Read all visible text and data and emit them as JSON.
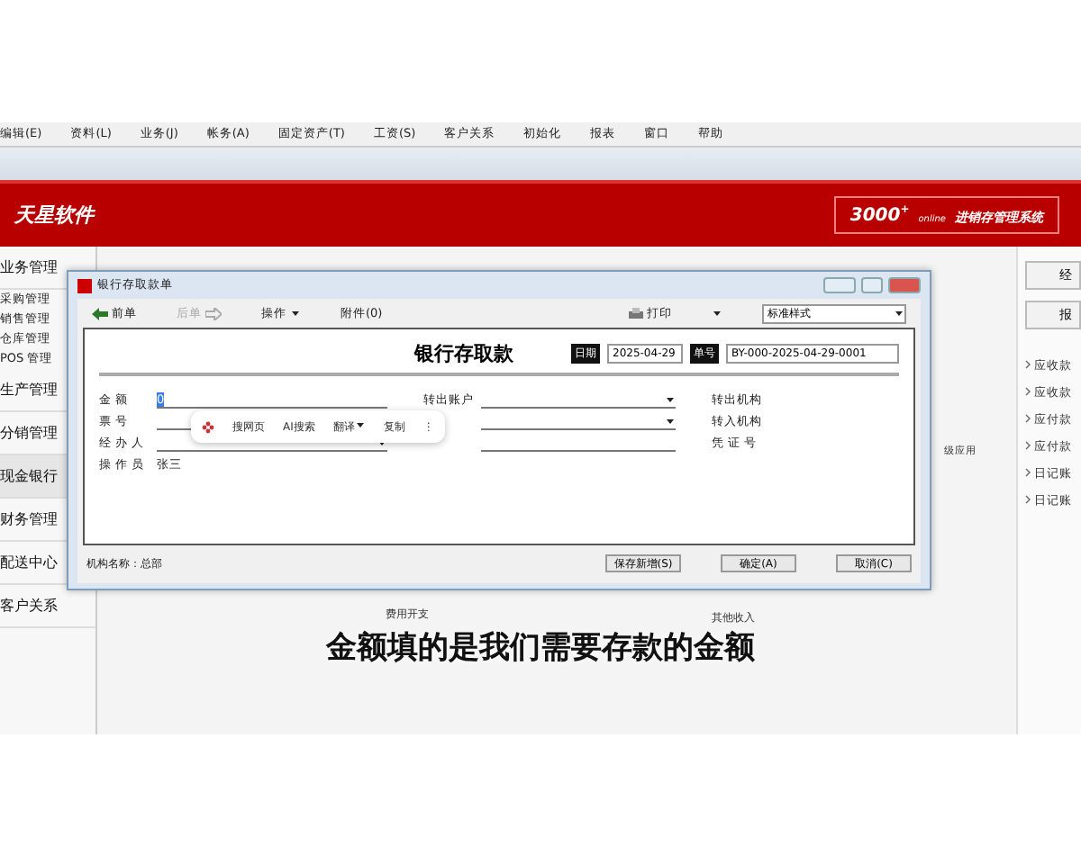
{
  "menu": [
    "编辑(E)",
    "资料(L)",
    "业务(J)",
    "帐务(A)",
    "固定资产(T)",
    "工资(S)",
    "客户关系",
    "初始化",
    "报表",
    "窗口",
    "帮助"
  ],
  "banner": {
    "logo": "天星软件",
    "product_number": "3000",
    "product_sup": "+",
    "product_tag": "online",
    "product_name": "进销存管理系统"
  },
  "sidebar": [
    {
      "label": "业务管理",
      "kind": "header",
      "selected": false,
      "children": [
        {
          "label": "采购管理"
        },
        {
          "label": "销售管理"
        },
        {
          "label": "仓库管理"
        },
        {
          "label": "POS 管理"
        }
      ]
    },
    {
      "label": "生产管理",
      "kind": "header",
      "selected": false
    },
    {
      "label": "分销管理",
      "kind": "header",
      "selected": false
    },
    {
      "label": "现金银行",
      "kind": "header",
      "selected": true
    },
    {
      "label": "财务管理",
      "kind": "header",
      "selected": false
    },
    {
      "label": "配送中心",
      "kind": "header",
      "selected": false
    },
    {
      "label": "客户关系",
      "kind": "header",
      "selected": false
    }
  ],
  "background": {
    "tile_label": "级应用",
    "flow_labels": [
      "费用开支",
      "其他收入"
    ]
  },
  "right_panel": {
    "buttons": [
      "经",
      "报"
    ],
    "links": [
      "应收款",
      "应收款",
      "应付款",
      "应付款",
      "日记账",
      "日记账"
    ]
  },
  "dialog": {
    "title": "银行存取款单",
    "toolbar": [
      {
        "label": "前单",
        "kind": "prev",
        "disabled": false
      },
      {
        "label": "后单",
        "kind": "next",
        "disabled": true
      },
      {
        "label": "操作",
        "kind": "menu",
        "disabled": false
      },
      {
        "label": "附件(0)",
        "kind": "plain",
        "disabled": false
      }
    ],
    "print": "打印",
    "style_select": "标准样式",
    "form_title": "银行存取款",
    "date_label": "日期",
    "date": "2025-04-29",
    "number_label": "单号",
    "number": "BY-000-2025-04-29-0001",
    "col1": [
      {
        "label": "金 额",
        "value": "0",
        "kind": "input",
        "highlighted": true
      },
      {
        "label": "票 号",
        "kind": "input"
      },
      {
        "label": "经 办 人",
        "kind": "select"
      },
      {
        "label": "操 作 员",
        "value": "张三",
        "kind": "text"
      }
    ],
    "col2": [
      {
        "label": "转出账户",
        "kind": "select"
      },
      {
        "kind": "select"
      },
      {
        "kind": "input"
      }
    ],
    "col3": [
      "转出机构",
      "转入机构",
      "凭 证 号"
    ],
    "org": "机构名称：总部",
    "buttons": [
      "保存新增(S)",
      "确定(A)",
      "取消(C)"
    ]
  },
  "popup": {
    "items": [
      {
        "label": "搜网页",
        "dropdown": false
      },
      {
        "label": "AI搜索",
        "dropdown": false
      },
      {
        "label": "翻译",
        "dropdown": true
      },
      {
        "label": "复制",
        "dropdown": false
      }
    ],
    "more": "⋮"
  },
  "subtitle": "金额填的是我们需要存款的金额"
}
